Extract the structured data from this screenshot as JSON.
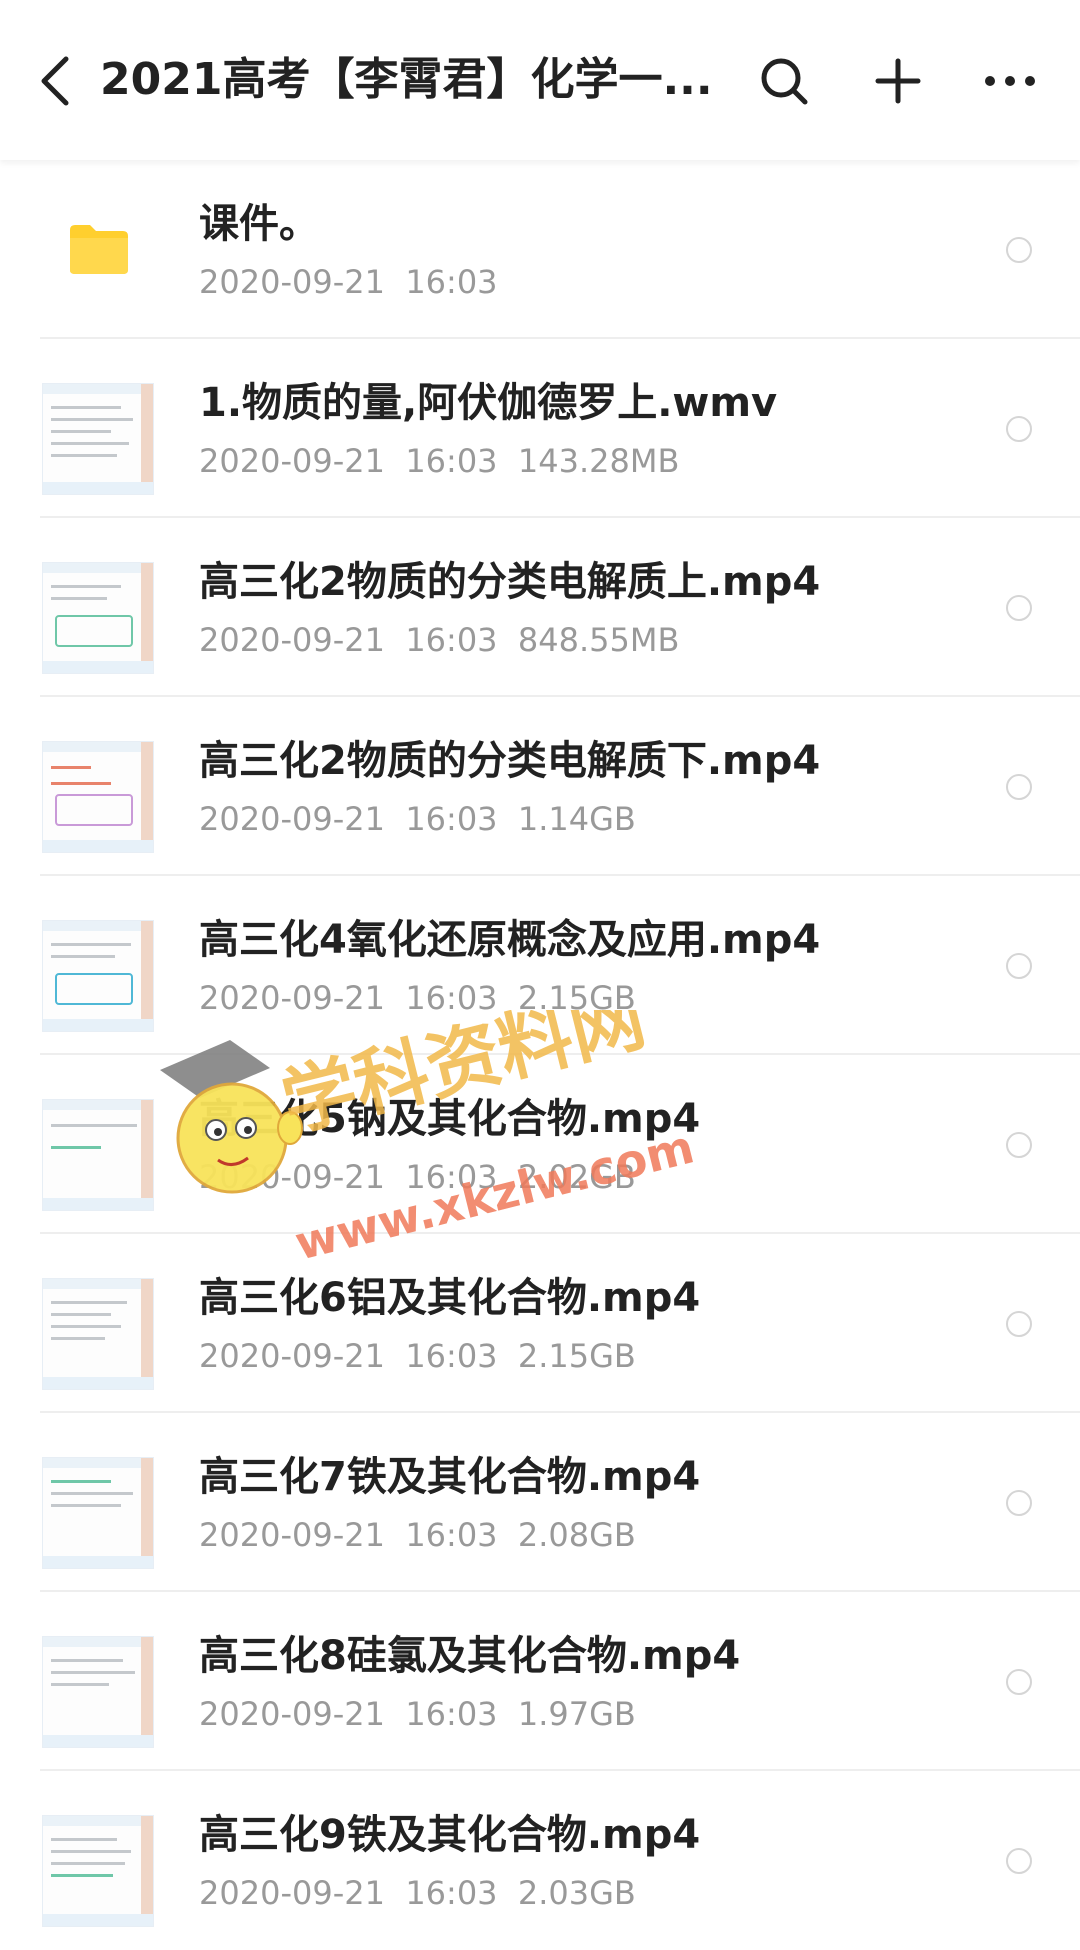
{
  "header": {
    "title": "2021高考【李霄君】化学一...",
    "icons": [
      "back-arrow-icon",
      "search-icon",
      "plus-icon",
      "more-icon"
    ]
  },
  "files": [
    {
      "type": "folder",
      "name": "课件。",
      "date": "2020-09-21",
      "time": "16:03",
      "size": ""
    },
    {
      "type": "video",
      "name": "1.物质的量,阿伏伽德罗上.wmv",
      "date": "2020-09-21",
      "time": "16:03",
      "size": "143.28MB"
    },
    {
      "type": "video",
      "name": "高三化2物质的分类电解质上.mp4",
      "date": "2020-09-21",
      "time": "16:03",
      "size": "848.55MB"
    },
    {
      "type": "video",
      "name": "高三化2物质的分类电解质下.mp4",
      "date": "2020-09-21",
      "time": "16:03",
      "size": "1.14GB"
    },
    {
      "type": "video",
      "name": "高三化4氧化还原概念及应用.mp4",
      "date": "2020-09-21",
      "time": "16:03",
      "size": "2.15GB"
    },
    {
      "type": "video",
      "name": "高三化5钠及其化合物.mp4",
      "date": "2020-09-21",
      "time": "16:03",
      "size": "2.02GB"
    },
    {
      "type": "video",
      "name": "高三化6铝及其化合物.mp4",
      "date": "2020-09-21",
      "time": "16:03",
      "size": "2.15GB"
    },
    {
      "type": "video",
      "name": "高三化7铁及其化合物.mp4",
      "date": "2020-09-21",
      "time": "16:03",
      "size": "2.08GB"
    },
    {
      "type": "video",
      "name": "高三化8硅氯及其化合物.mp4",
      "date": "2020-09-21",
      "time": "16:03",
      "size": "1.97GB"
    },
    {
      "type": "video",
      "name": "高三化9铁及其化合物.mp4",
      "date": "2020-09-21",
      "time": "16:03",
      "size": "2.03GB"
    }
  ],
  "watermark": {
    "text_cn": "学科资料网",
    "text_url": "www.xkzlw.com",
    "colors": {
      "cn1": "#f2b94a",
      "cn2": "#5cc6e8",
      "cn3": "#8ad04a",
      "url": "#f07a5a"
    }
  },
  "colors": {
    "background": "#ffffff",
    "title_text": "#222222",
    "meta_text": "#999999",
    "folder": "#ffcf2e",
    "divider": "#eeeeee",
    "radio_border": "#d5d5d5"
  }
}
